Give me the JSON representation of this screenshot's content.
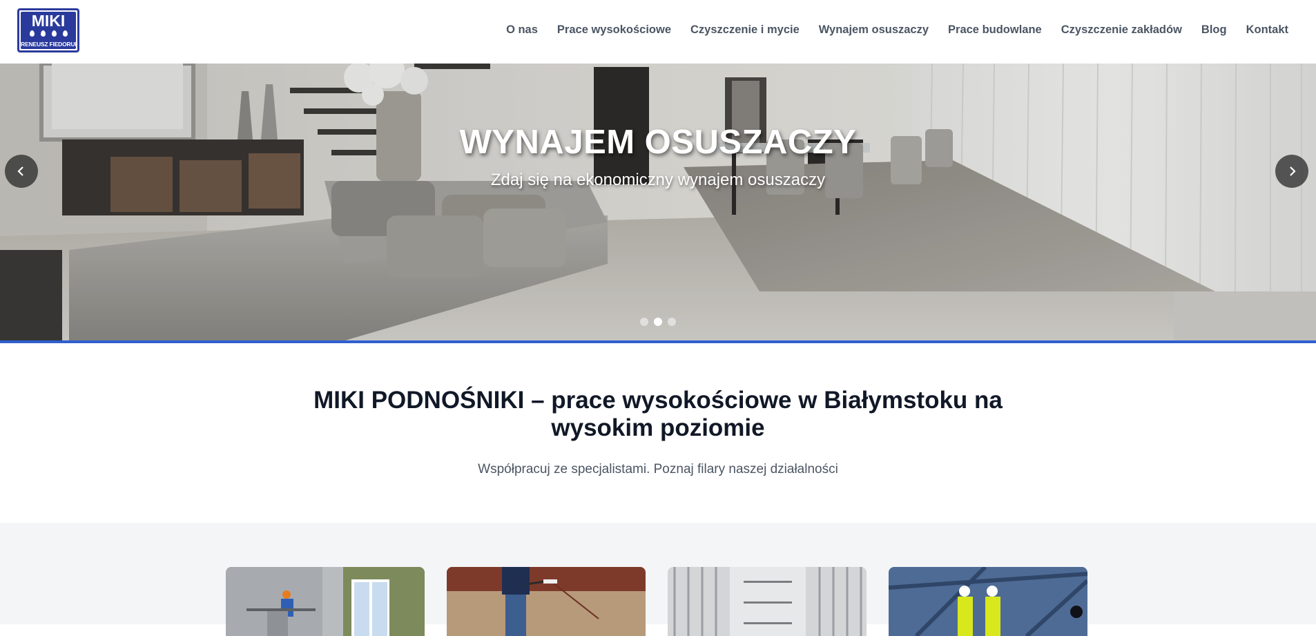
{
  "header": {
    "logo": {
      "name": "MIKI",
      "owner": "IRENEUSZ FIEDORUK"
    },
    "nav": [
      {
        "label": "O nas"
      },
      {
        "label": "Prace wysokościowe"
      },
      {
        "label": "Czyszczenie i mycie"
      },
      {
        "label": "Wynajem osuszaczy"
      },
      {
        "label": "Prace budowlane"
      },
      {
        "label": "Czyszczenie zakładów"
      },
      {
        "label": "Blog"
      },
      {
        "label": "Kontakt"
      }
    ]
  },
  "hero": {
    "title": "WYNAJEM OSUSZACZY",
    "subtitle": "Zdaj się na ekonomiczny wynajem osuszaczy",
    "slides_total": 3,
    "active_slide": 2,
    "accent_color": "#2f5fd0"
  },
  "intro": {
    "title": "MIKI PODNOŚNIKI – prace wysokościowe w Białymstoku na wysokim poziomie",
    "subtitle": "Współpracuj ze specjalistami. Poznaj filary naszej działalności"
  },
  "icons": {
    "prev": "chevron-left-icon",
    "next": "chevron-right-icon"
  }
}
